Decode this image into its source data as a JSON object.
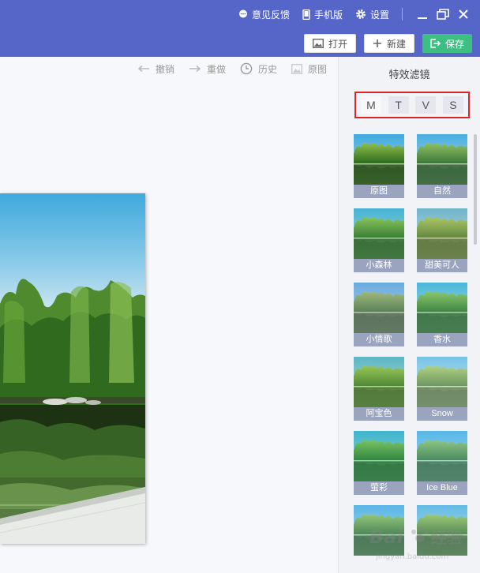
{
  "topbar": {
    "feedback": "意见反馈",
    "mobile": "手机版",
    "settings": "设置",
    "open": "打开",
    "new": "新建",
    "save": "保存"
  },
  "tools": {
    "undo": "撤销",
    "redo": "重做",
    "history": "历史",
    "original": "原图"
  },
  "panel": {
    "title": "特效滤镜",
    "tabs": [
      "M",
      "T",
      "V",
      "S"
    ],
    "filters": [
      "原图",
      "自然",
      "小森林",
      "甜美可人",
      "小情歌",
      "香水",
      "阿宝色",
      "Snow",
      "萤彩",
      "Ice Blue"
    ]
  },
  "colors": {
    "topbar": "#5566c8",
    "save_button": "#3dbf84",
    "highlight_border": "#d8262b"
  }
}
